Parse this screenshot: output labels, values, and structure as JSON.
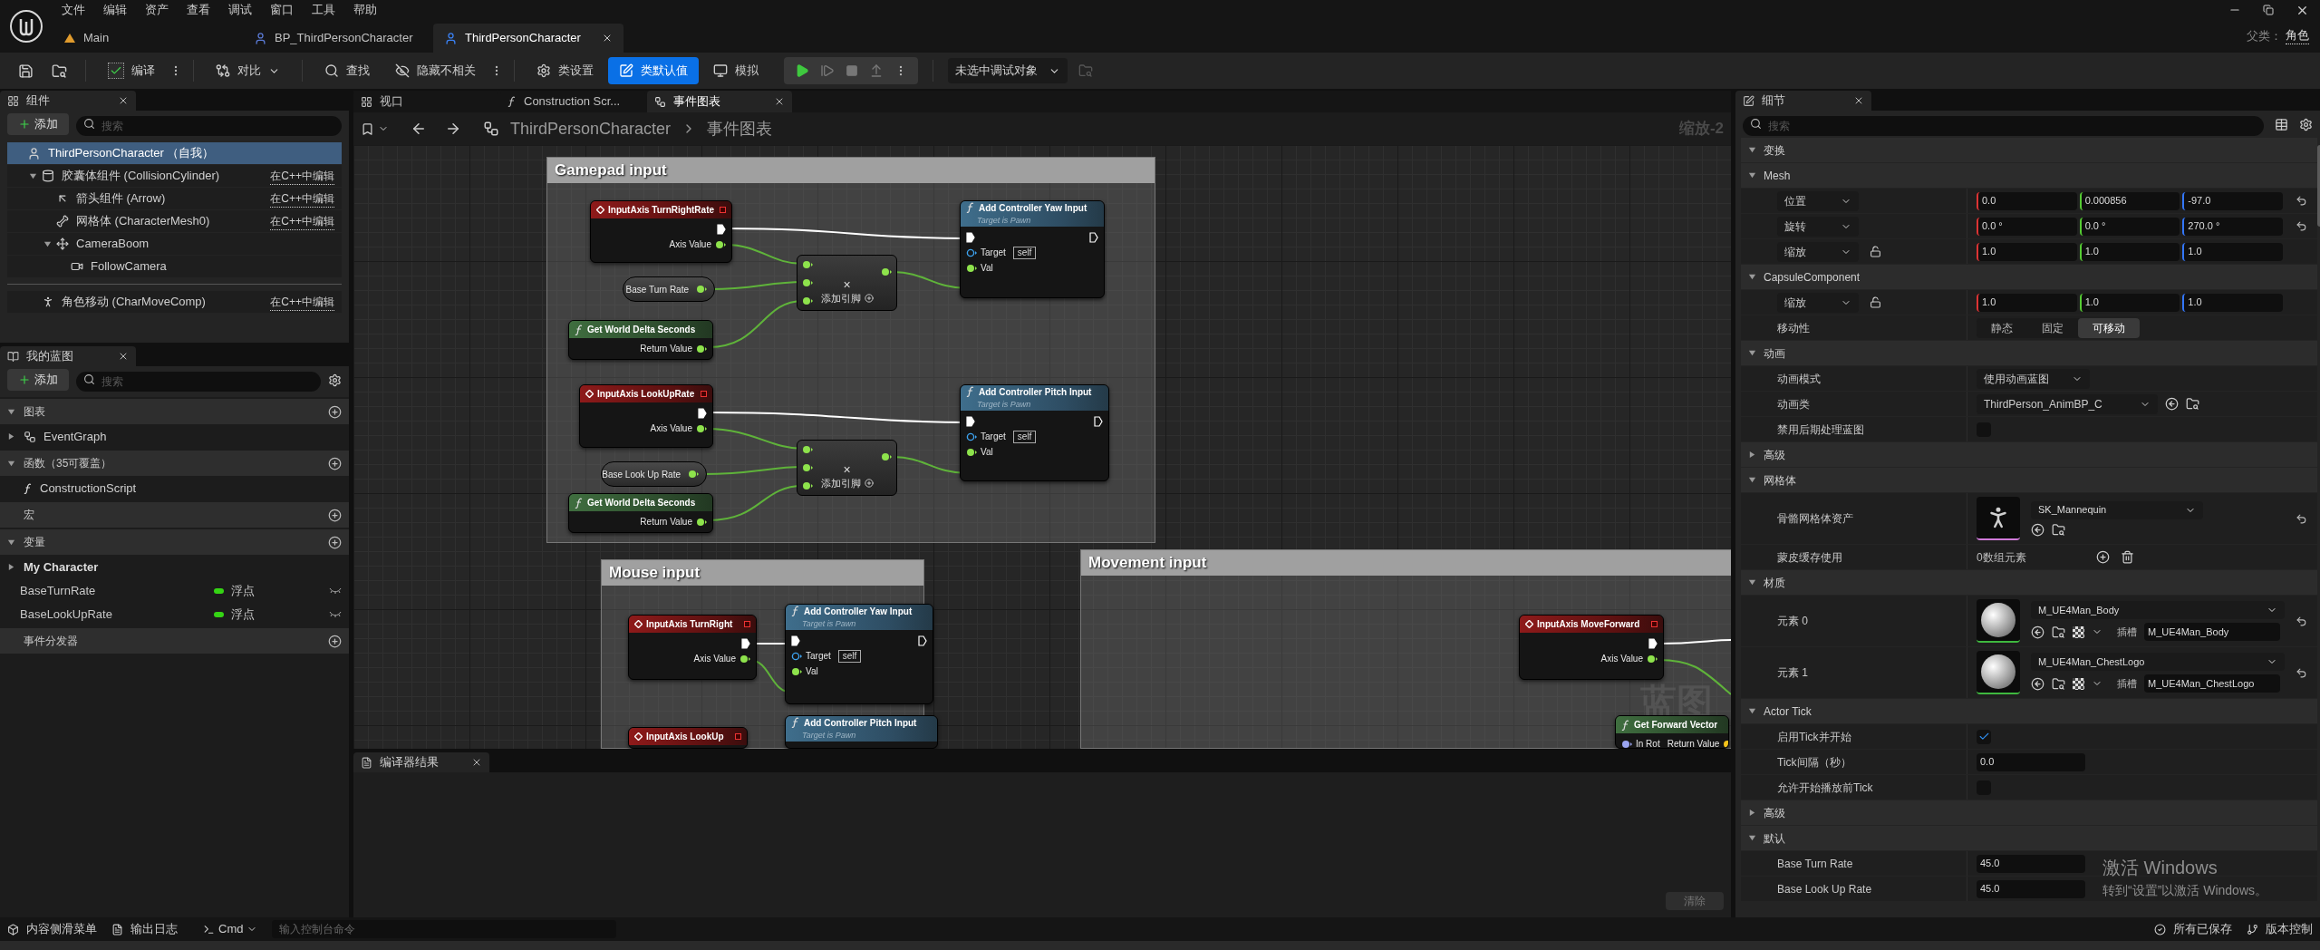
{
  "title_bar": {
    "menu": [
      "文件",
      "编辑",
      "资产",
      "查看",
      "调试",
      "窗口",
      "工具",
      "帮助"
    ],
    "tabs": [
      {
        "label": "Main",
        "kind": "level",
        "selected": false
      },
      {
        "label": "BP_ThirdPersonCharacter",
        "kind": "blueprint",
        "selected": false
      },
      {
        "label": "ThirdPersonCharacter",
        "kind": "blueprint",
        "selected": true
      }
    ],
    "parent_label": "父类：",
    "parent_value": "角色"
  },
  "toolbar": {
    "buttons": [
      {
        "kind": "compile",
        "label": "编译",
        "selected": false
      },
      {
        "kind": "diff",
        "label": "对比",
        "selected": false
      },
      {
        "kind": "find",
        "label": "查找",
        "selected": false
      },
      {
        "kind": "hide",
        "label": "隐藏不相关",
        "selected": false
      },
      {
        "kind": "settings",
        "label": "类设置",
        "selected": false
      },
      {
        "kind": "defaults",
        "label": "类默认值",
        "selected": true
      },
      {
        "kind": "simulate",
        "label": "模拟",
        "selected": false
      }
    ],
    "debug_target": "未选中调试对象"
  },
  "components": {
    "tab": "组件",
    "add": "添加",
    "search": {
      "placeholder": "搜索"
    },
    "tree": [
      {
        "kind": "actor",
        "label": "ThirdPersonCharacter （自我）",
        "selected": true,
        "children": [
          {
            "kind": "capsule",
            "label": "胶囊体组件 (CollisionCylinder)",
            "link": "在C++中编辑",
            "selected": false,
            "expanded": true,
            "children": [
              {
                "kind": "arrow",
                "label": "箭头组件 (Arrow)",
                "link": "在C++中编辑",
                "selected": false
              },
              {
                "kind": "mesh",
                "label": "网格体 (CharacterMesh0)",
                "link": "在C++中编辑",
                "selected": false
              },
              {
                "kind": "boom",
                "label": "CameraBoom",
                "selected": false,
                "expanded": true,
                "children": [
                  {
                    "kind": "camera",
                    "label": "FollowCamera",
                    "selected": false
                  }
                ]
              }
            ]
          }
        ]
      }
    ],
    "others": [
      {
        "kind": "movement",
        "label": "角色移动 (CharMoveComp)",
        "link": "在C++中编辑",
        "selected": false
      }
    ]
  },
  "my_blueprint": {
    "tab": "我的蓝图",
    "add": "添加",
    "search": {
      "placeholder": "搜索"
    },
    "sections": [
      {
        "title": "图表",
        "expanded": true,
        "items": [
          {
            "kind": "graph",
            "label": "EventGraph",
            "expanded": false
          }
        ]
      },
      {
        "title": "函数（35可覆盖）",
        "expanded": true,
        "items": [
          {
            "kind": "function",
            "label": "ConstructionScript"
          }
        ]
      },
      {
        "title": "宏"
      },
      {
        "title": "变量",
        "expanded": true,
        "items": [
          {
            "kind": "category",
            "label": "My Character",
            "expanded": false
          },
          {
            "kind": "variable",
            "label": "BaseTurnRate",
            "type": "浮点",
            "color": "#35d414"
          },
          {
            "kind": "variable",
            "label": "BaseLookUpRate",
            "type": "浮点",
            "color": "#35d414"
          }
        ]
      },
      {
        "title": "事件分发器"
      }
    ]
  },
  "graph": {
    "tabs": [
      {
        "kind": "viewport",
        "label": "视口",
        "selected": false
      },
      {
        "kind": "function",
        "label": "Construction Scr...",
        "selected": false
      },
      {
        "kind": "graph",
        "label": "事件图表",
        "selected": true
      }
    ],
    "breadcrumb": [
      "ThirdPersonCharacter",
      "事件图表"
    ],
    "zoom": "缩放-2",
    "corner_label": "蓝图",
    "comments": [
      "Gamepad input",
      "Mouse input",
      "Movement input"
    ],
    "nodes": [
      {
        "kind": "event",
        "title": "InputAxis TurnRightRate",
        "outputs": [
          {
            "kind": "exec",
            "connected": true
          },
          {
            "kind": "float",
            "label": "Axis Value"
          }
        ]
      },
      {
        "kind": "variable",
        "title": "Base Turn Rate"
      },
      {
        "kind": "pure",
        "title": "Get World Delta Seconds",
        "outputs": [
          {
            "kind": "float",
            "label": "Return Value"
          }
        ]
      },
      {
        "kind": "math",
        "symbol": "×",
        "footer": "添加引脚"
      },
      {
        "kind": "function",
        "title": "Add Controller Yaw Input",
        "subtitle": "Target is Pawn",
        "inputs": [
          {
            "kind": "exec",
            "connected": true
          },
          {
            "kind": "object",
            "label": "Target",
            "value": "self"
          },
          {
            "kind": "float",
            "label": "Val"
          }
        ],
        "outputs": [
          {
            "kind": "exec",
            "connected": false
          }
        ]
      },
      {
        "kind": "event",
        "title": "InputAxis LookUpRate",
        "outputs": [
          {
            "kind": "exec",
            "connected": true
          },
          {
            "kind": "float",
            "label": "Axis Value"
          }
        ]
      },
      {
        "kind": "variable",
        "title": "Base Look Up Rate"
      },
      {
        "kind": "pure",
        "title": "Get World Delta Seconds",
        "outputs": [
          {
            "kind": "float",
            "label": "Return Value"
          }
        ]
      },
      {
        "kind": "math",
        "symbol": "×",
        "footer": "添加引脚"
      },
      {
        "kind": "function",
        "title": "Add Controller Pitch Input",
        "subtitle": "Target is Pawn",
        "inputs": [
          {
            "kind": "exec",
            "connected": true
          },
          {
            "kind": "object",
            "label": "Target",
            "value": "self"
          },
          {
            "kind": "float",
            "label": "Val"
          }
        ],
        "outputs": [
          {
            "kind": "exec",
            "connected": false
          }
        ]
      },
      {
        "kind": "event",
        "title": "InputAxis TurnRight",
        "outputs": [
          {
            "kind": "exec",
            "connected": true
          },
          {
            "kind": "float",
            "label": "Axis Value"
          }
        ]
      },
      {
        "kind": "function",
        "title": "Add Controller Yaw Input",
        "subtitle": "Target is Pawn",
        "inputs": [
          {
            "kind": "exec",
            "connected": true
          },
          {
            "kind": "object",
            "label": "Target",
            "value": "self"
          },
          {
            "kind": "float",
            "label": "Val"
          }
        ],
        "outputs": [
          {
            "kind": "exec",
            "connected": false
          }
        ]
      },
      {
        "kind": "event",
        "title": "InputAxis LookUp"
      },
      {
        "kind": "function",
        "title": "Add Controller Pitch Input",
        "subtitle": "Target is Pawn"
      },
      {
        "kind": "event",
        "title": "InputAxis MoveForward",
        "outputs": [
          {
            "kind": "exec",
            "connected": true
          },
          {
            "kind": "float",
            "label": "Axis Value"
          }
        ]
      },
      {
        "kind": "pure",
        "title": "Get Forward Vector",
        "inputs": [
          {
            "kind": "rotator",
            "label": "In Rot"
          }
        ],
        "outputs": [
          {
            "kind": "vector",
            "label": "Return Value"
          }
        ]
      }
    ]
  },
  "compiler": {
    "tab": "编译器结果",
    "clear": "清除"
  },
  "details": {
    "tab": "细节",
    "search": {
      "placeholder": "搜索"
    },
    "sections": [
      {
        "title": "变换",
        "expanded": true
      },
      {
        "title": "Mesh",
        "expanded": true,
        "rows": [
          {
            "kind": "vector",
            "label": "位置",
            "values": [
              "0.0",
              "0.000856",
              "-97.0"
            ],
            "lock": false,
            "reset": true
          },
          {
            "kind": "vector",
            "label": "旋转",
            "values": [
              "0.0 °",
              "0.0 °",
              "270.0 °"
            ],
            "lock": false,
            "reset": true
          },
          {
            "kind": "vector",
            "label": "缩放",
            "values": [
              "1.0",
              "1.0",
              "1.0"
            ],
            "lock": true,
            "reset": false
          }
        ]
      },
      {
        "title": "CapsuleComponent",
        "expanded": true,
        "rows": [
          {
            "kind": "vector",
            "label": "缩放",
            "values": [
              "1.0",
              "1.0",
              "1.0"
            ],
            "lock": true,
            "reset": false
          },
          {
            "kind": "mobility",
            "label": "移动性",
            "options": [
              {
                "label": "静态",
                "selected": false
              },
              {
                "label": "固定",
                "selected": false
              },
              {
                "label": "可移动",
                "selected": true
              }
            ]
          }
        ]
      },
      {
        "title": "动画",
        "expanded": true,
        "rows": [
          {
            "kind": "dropdown",
            "label": "动画模式",
            "value": "使用动画蓝图",
            "browse": false
          },
          {
            "kind": "dropdown",
            "label": "动画类",
            "value": "ThirdPerson_AnimBP_C",
            "browse": true
          },
          {
            "kind": "checkbox",
            "label": "禁用后期处理蓝图",
            "checked": false
          }
        ]
      },
      {
        "title": "高级",
        "expanded": false
      },
      {
        "title": "网格体",
        "expanded": true,
        "rows": [
          {
            "kind": "asset",
            "label": "骨骼网格体资产",
            "value": "SK_Mannequin",
            "reset": true
          },
          {
            "kind": "array",
            "label": "蒙皮缓存使用",
            "value": "0数组元素"
          }
        ]
      },
      {
        "title": "材质",
        "expanded": true,
        "rows": [
          {
            "kind": "material",
            "label": "元素 0",
            "value": "M_UE4Man_Body",
            "slot_label": "插槽",
            "slot": "M_UE4Man_Body",
            "reset": true
          },
          {
            "kind": "material",
            "label": "元素 1",
            "value": "M_UE4Man_ChestLogo",
            "slot_label": "插槽",
            "slot": "M_UE4Man_ChestLogo",
            "reset": true
          }
        ]
      },
      {
        "title": "Actor Tick",
        "expanded": true,
        "rows": [
          {
            "kind": "checkbox",
            "label": "启用Tick并开始",
            "checked": true
          },
          {
            "kind": "text",
            "label": "Tick间隔（秒）",
            "value": "0.0"
          },
          {
            "kind": "checkbox",
            "label": "允许开始播放前Tick",
            "checked": false
          }
        ]
      },
      {
        "title": "高级",
        "expanded": false
      },
      {
        "title": "默认",
        "expanded": true,
        "rows": [
          {
            "kind": "text",
            "label": "Base Turn Rate",
            "value": "45.0"
          },
          {
            "kind": "text",
            "label": "Base Look Up Rate",
            "value": "45.0"
          }
        ]
      }
    ]
  },
  "status_bar": {
    "content_drawer": "内容侧滑菜单",
    "output_log": "输出日志",
    "cmd": "Cmd",
    "console": {
      "placeholder": "输入控制台命令"
    },
    "saved": "所有已保存",
    "source_control": "版本控制"
  },
  "os_notice": {
    "title": "激活 Windows",
    "text": "转到“设置”以激活 Windows。"
  }
}
